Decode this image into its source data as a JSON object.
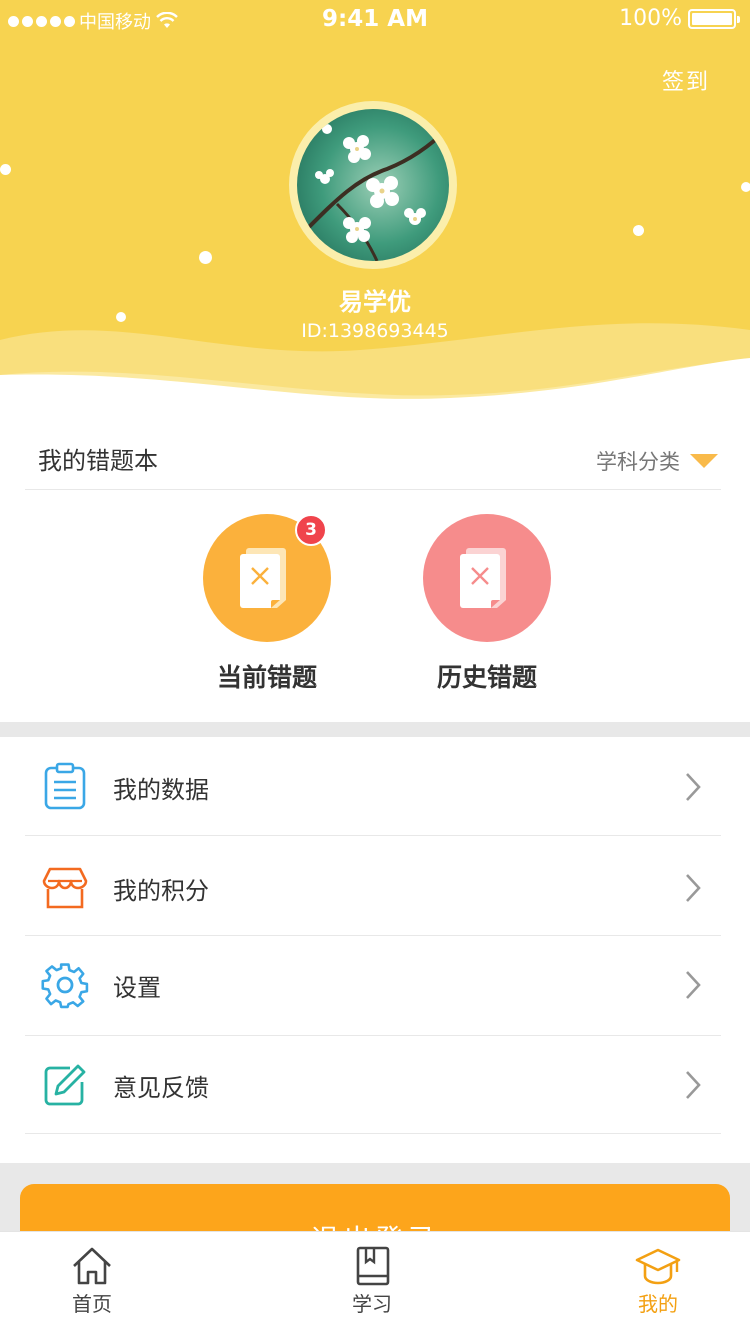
{
  "status_bar": {
    "carrier": "中国移动",
    "time": "9:41 AM",
    "battery": "100%"
  },
  "header": {
    "checkin_label": "签到",
    "username": "易学优",
    "user_id": "ID:1398693445",
    "background_color": "#f7d350"
  },
  "wrong_questions": {
    "title": "我的错题本",
    "filter_label": "学科分类",
    "current": {
      "label": "当前错题",
      "badge": "3",
      "color": "#fbb13c"
    },
    "history": {
      "label": "历史错题",
      "color": "#f68c8c"
    }
  },
  "menu": {
    "items": [
      {
        "label": "我的数据",
        "icon": "clipboard-icon",
        "color": "#3aa7e6"
      },
      {
        "label": "我的积分",
        "icon": "store-icon",
        "color": "#f36a20"
      },
      {
        "label": "设置",
        "icon": "gear-icon",
        "color": "#3aa7e6"
      },
      {
        "label": "意见反馈",
        "icon": "edit-icon",
        "color": "#27b2a3"
      }
    ]
  },
  "logout_label": "退出登录",
  "tabs": [
    {
      "label": "首页",
      "icon": "home-icon",
      "active": false
    },
    {
      "label": "学习",
      "icon": "book-icon",
      "active": false
    },
    {
      "label": "我的",
      "icon": "graduation-cap-icon",
      "active": true
    }
  ],
  "accent_color": "#fda51b"
}
